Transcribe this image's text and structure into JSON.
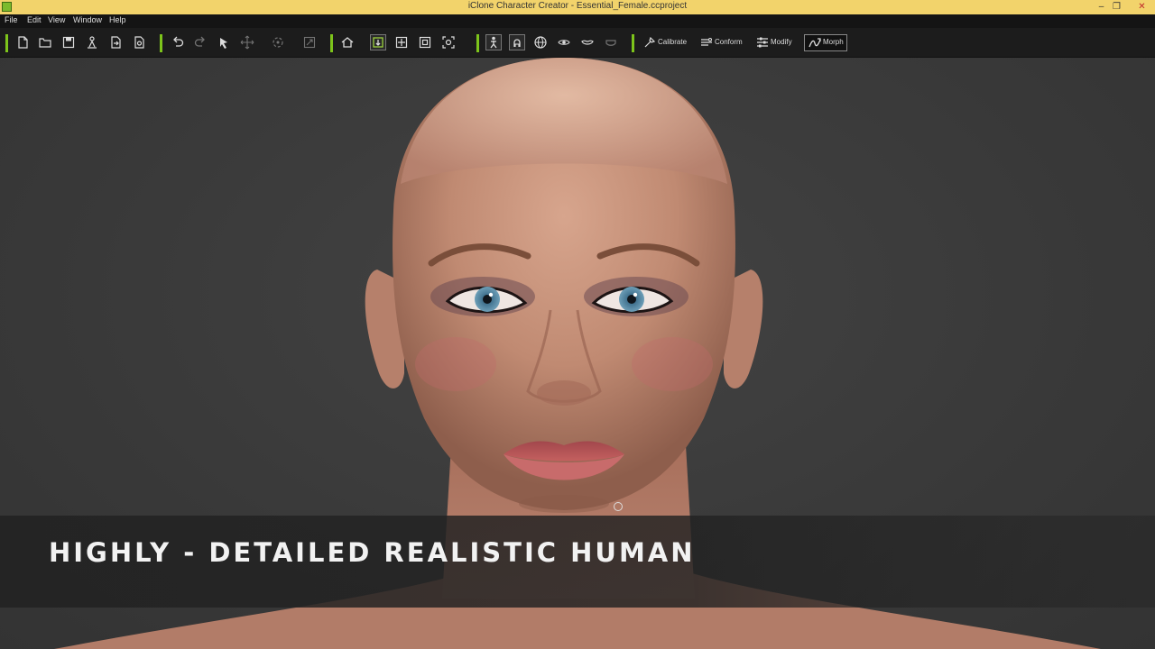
{
  "window": {
    "title": "iClone Character Creator - Essential_Female.ccproject",
    "controls": {
      "minimize": "–",
      "restore": "❐",
      "close": "✕"
    }
  },
  "menu": {
    "items": [
      "File",
      "Edit",
      "View",
      "Window",
      "Help"
    ]
  },
  "toolbar": {
    "calibrate_label": "Calibrate",
    "conform_label": "Conform",
    "modify_label": "Modify",
    "morph_label": "Morph",
    "accent_color": "#7dc41b"
  },
  "viewport": {
    "caption": "HIGHLY - DETAILED REALISTIC HUMAN"
  }
}
